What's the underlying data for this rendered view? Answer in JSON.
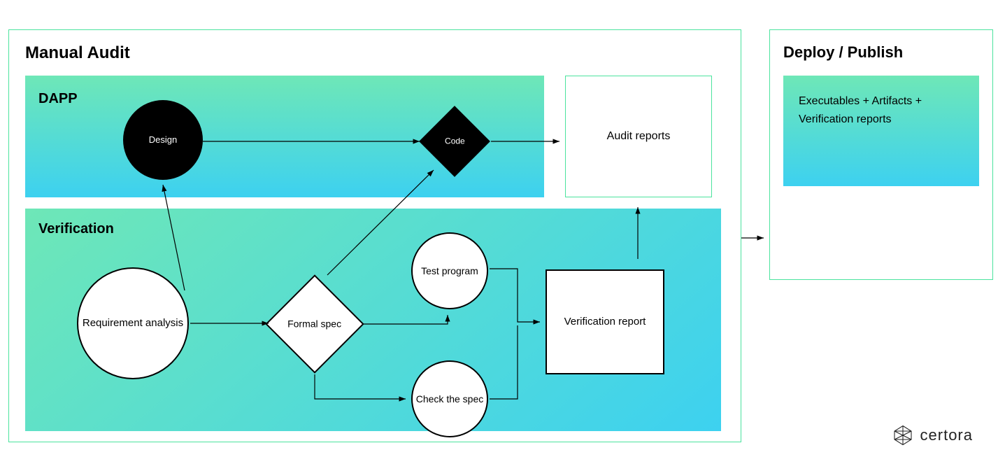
{
  "manual_audit": {
    "title": "Manual  Audit"
  },
  "dapp": {
    "title": "DAPP",
    "design": "Design",
    "code": "Code"
  },
  "audit_reports": "Audit reports",
  "verification": {
    "title": "Verification",
    "requirement": "Requirement analysis",
    "formal_spec": "Formal spec",
    "test_program": "Test program",
    "check_spec": "Check the spec",
    "report": "Verification report"
  },
  "deploy": {
    "title": "Deploy / Publish",
    "body": "Executables + Artifacts + Verification reports"
  },
  "brand": "certora"
}
